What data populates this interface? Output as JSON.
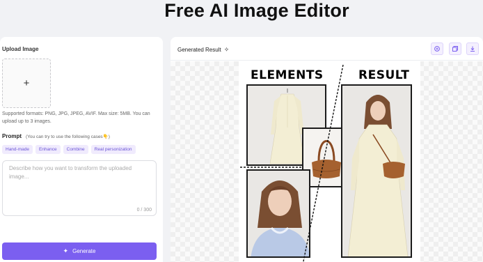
{
  "page": {
    "title": "Free AI Image Editor"
  },
  "upload": {
    "label": "Upload Image",
    "plus": "+",
    "formats_note": "Supported formats: PNG, JPG, JPEG, AVIF. Max size: 5MB. You can upload up to 3 images."
  },
  "prompt": {
    "label": "Prompt",
    "hint": "(You can try to use the following cases👇)",
    "chips": [
      "Hand-made",
      "Enhance",
      "Combine",
      "Real personization"
    ],
    "placeholder": "Describe how you want to transform the uploaded image...",
    "value": "",
    "char_count": "0 / 300"
  },
  "generate": {
    "label": "Generate",
    "icon": "sparkle-icon"
  },
  "result": {
    "title": "Generated Result",
    "title_icon": "sparkle-icon",
    "tools": [
      "zoom-icon",
      "copy-icon",
      "download-icon"
    ]
  },
  "collage": {
    "left_heading": "ELEMENTS",
    "right_heading": "RESULT"
  },
  "colors": {
    "accent": "#7b5ff0",
    "chip_bg": "#f0ebfd",
    "chip_text": "#6a54d6",
    "dress": "#f1ecd2",
    "bag": "#a5612f",
    "blouse": "#b9c9e6"
  }
}
